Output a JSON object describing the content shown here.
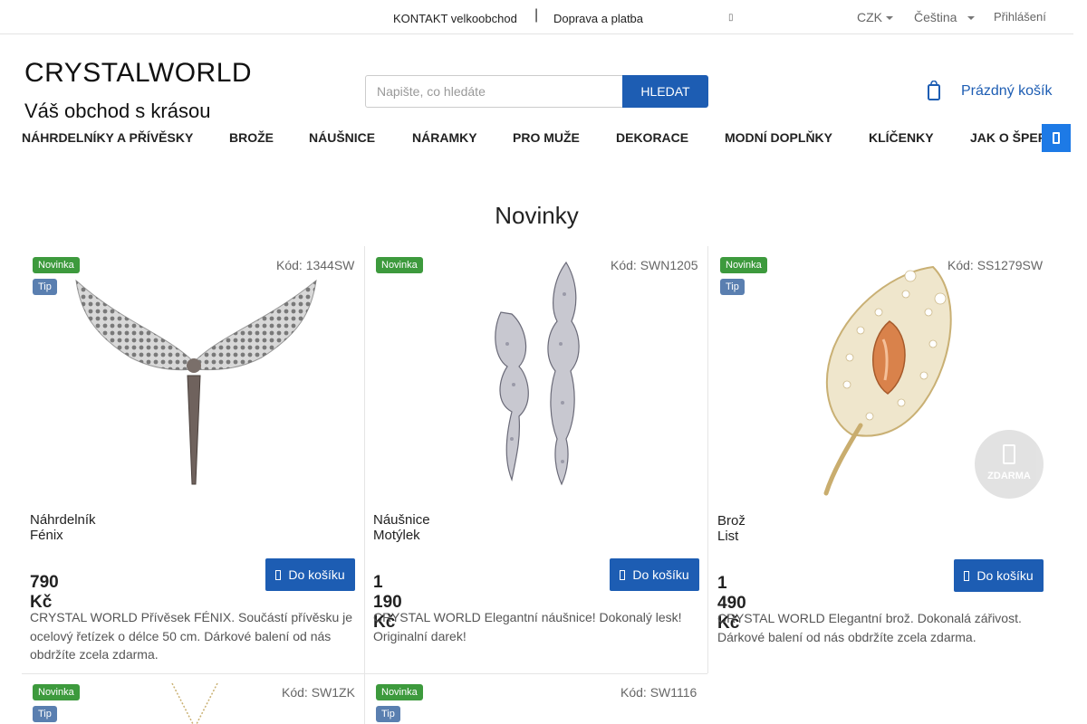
{
  "topbar": {
    "contact": "KONTAKT velkoobchod",
    "separator": "|",
    "shipping": "Doprava a platba",
    "currency": "CZK",
    "language": "Čeština",
    "login": "Přihlášení"
  },
  "header": {
    "logo": "CRYSTALWORLD",
    "tagline": "Váš obchod s krásou",
    "search_placeholder": "Napište, co hledáte",
    "search_button": "HLEDAT",
    "cart": "Prázdný košík"
  },
  "nav": {
    "items": [
      "NÁHRDELNÍKY A PŘÍVĚSKY",
      "BROŽE",
      "NÁUŠNICE",
      "NÁRAMKY",
      "PRO MUŽE",
      "DEKORACE",
      "MODNÍ DOPLŇKY",
      "KLÍČENKY",
      "JAK O ŠPERKY"
    ]
  },
  "section": {
    "title": "Novinky"
  },
  "badges": {
    "new": "Novinka",
    "tip": "Tip",
    "free": "ZDARMA"
  },
  "products": [
    {
      "code": "Kód: 1344SW",
      "name": "Náhrdelník Fénix",
      "price": "790 Kč",
      "button": "Do košíku",
      "description": "CRYSTAL WORLD  Přívěsek FÉNIX. Součástí přívěsku je  ocelový řetízek o délce 50 cm. Dárkové balení od nás obdržíte zcela zdarma."
    },
    {
      "code": "Kód: SWN1205",
      "name": "Náušnice Motýlek",
      "price": "1 190 Kč",
      "button": "Do košíku",
      "description": "CRYSTAL WORLD  Elegantní náušnice! Dokonalý lesk! Originalní darek!"
    },
    {
      "code": "Kód: SS1279SW",
      "name": "Brož List",
      "price": "1 490 Kč",
      "button": "Do košíku",
      "description": "CRYSTAL WORLD  Elegantní brož. Dokonalá zářivost. Dárkové balení od nás obdržíte zcela zdarma."
    },
    {
      "code": "Kód: SW1ZK"
    },
    {
      "code": "Kód: SW1116"
    }
  ]
}
